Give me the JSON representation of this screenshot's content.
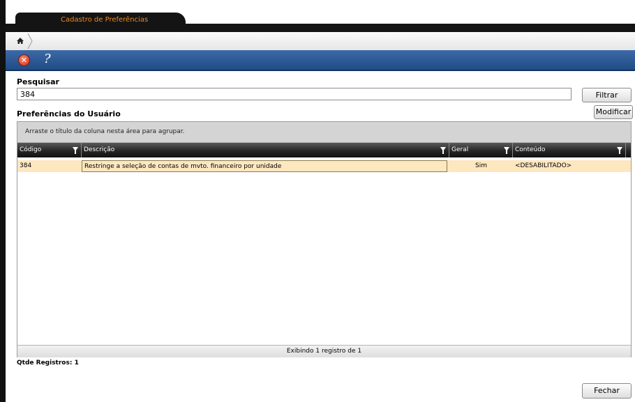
{
  "window": {
    "tab_title": "Cadastro de Preferências"
  },
  "toolbar": {
    "close_icon": "close-icon",
    "help_icon": "help-icon"
  },
  "search": {
    "label": "Pesquisar",
    "value": "384",
    "filter_button": "Filtrar"
  },
  "preferences": {
    "section_title": "Preferências do Usuário",
    "modify_button": "Modificar",
    "group_hint": "Arraste o título da coluna nesta área para agrupar.",
    "columns": [
      "Código",
      "Descrição",
      "Geral",
      "Conteúdo"
    ],
    "rows": [
      {
        "codigo": "384",
        "descricao": "Restringe a seleção de contas de mvto. financeiro por unidade",
        "geral": "Sim",
        "conteudo": "<DESABILITADO>"
      }
    ],
    "footer": "Exibindo 1 registro de 1"
  },
  "summary": {
    "qtde_label": "Qtde Registros:",
    "qtde_value": "1"
  },
  "close_button": "Fechar",
  "colors": {
    "toolbar": "#2a5590",
    "tab_text": "#f08a1c",
    "selected_row": "#fde7bf"
  }
}
